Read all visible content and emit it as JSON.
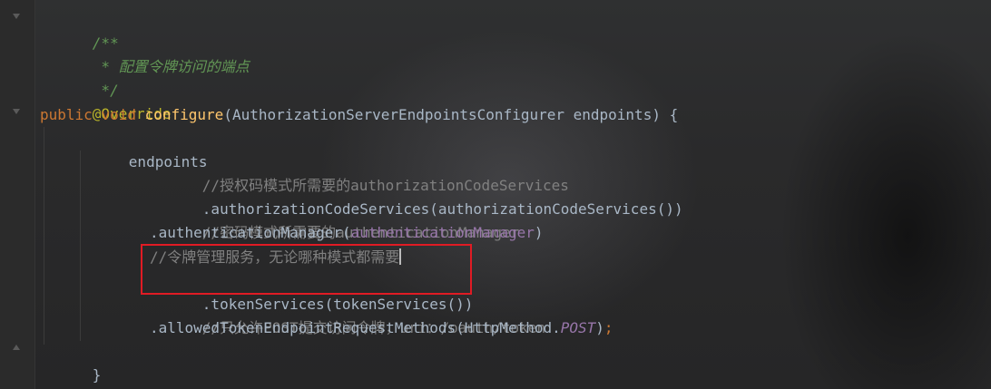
{
  "code": {
    "doc_open": "/**",
    "doc_text": " * 配置令牌访问的端点",
    "doc_close": " */",
    "annotation": "@Override",
    "kw_public": "public",
    "kw_void": "void",
    "method_name": "configure",
    "params": "(AuthorizationServerEndpointsConfigurer endpoints) {",
    "endpoints": "endpoints",
    "c1": "//授权码模式所需要的authorizationCodeServices",
    "l1": ".authorizationCodeServices(authorizationCodeServices())",
    "c2": "//密码模式所需要的authenticationManager",
    "l2_a": ".authenticationManager(",
    "l2_field": "authenticationManager",
    "l2_b": ")",
    "c3": "//令牌管理服务，无论哪种模式都需要",
    "l3": ".tokenServices(tokenServices())",
    "c4": "//只允许POST提交访问令牌，uri：/oauth/token",
    "l4_a": ".allowedTokenEndpointRequestMethods(HttpMethod.",
    "l4_field": "POST",
    "l4_b": ")",
    "l4_semi": ";",
    "close_brace": "}"
  },
  "colors": {
    "background": "#2b2b2b",
    "doc_comment": "#629755",
    "line_comment": "#808080",
    "annotation": "#bbb529",
    "keyword": "#cc7832",
    "method_declaration": "#ffc66d",
    "identifier": "#a9b7c6",
    "field": "#9876aa",
    "highlight_border": "#e01b24"
  }
}
